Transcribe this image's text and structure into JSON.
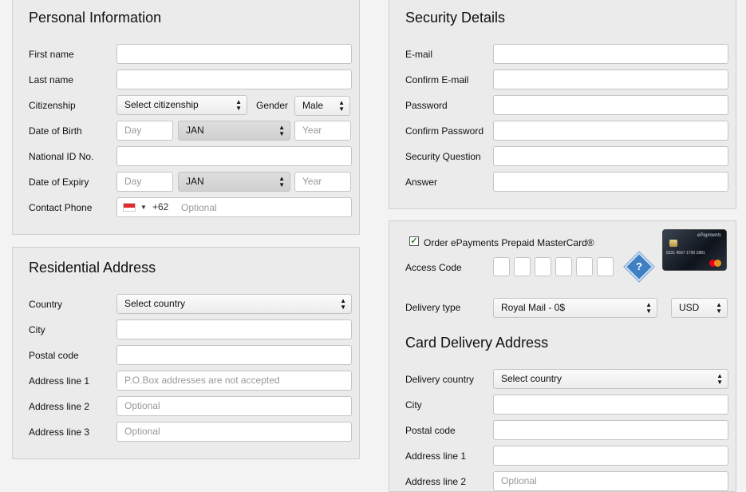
{
  "personal": {
    "title": "Personal Information",
    "first_name": "First name",
    "last_name": "Last name",
    "citizenship": "Citizenship",
    "citizenship_select": "Select citizenship",
    "gender": "Gender",
    "gender_value": "Male",
    "dob": "Date of Birth",
    "day_placeholder": "Day",
    "month_value": "JAN",
    "year_placeholder": "Year",
    "national_id": "National ID No.",
    "date_of_expiry": "Date of Expiry",
    "contact_phone": "Contact Phone",
    "phone_code": "+62",
    "phone_placeholder": "Optional"
  },
  "residential": {
    "title": "Residential Address",
    "country": "Country",
    "country_select": "Select country",
    "city": "City",
    "postal_code": "Postal code",
    "address1": "Address line 1",
    "address1_placeholder": "P.O.Box addresses are not accepted",
    "address2": "Address line 2",
    "address3": "Address line 3",
    "optional": "Optional"
  },
  "security": {
    "title": "Security Details",
    "email": "E-mail",
    "confirm_email": "Confirm E-mail",
    "password": "Password",
    "confirm_password": "Confirm Password",
    "security_question": "Security Question",
    "answer": "Answer"
  },
  "card": {
    "order_label": "Order ePayments Prepaid MasterCard®",
    "order_checked": true,
    "access_code": "Access Code",
    "delivery_type": "Delivery type",
    "delivery_value": "Royal Mail - 0$",
    "currency": "USD",
    "help_symbol": "?",
    "card_brand": "ePayments",
    "card_number": "5331 4567 1700 1881"
  },
  "delivery": {
    "title": "Card Delivery Address",
    "country": "Delivery country",
    "country_select": "Select country",
    "city": "City",
    "postal_code": "Postal code",
    "address1": "Address line 1",
    "address2": "Address line 2",
    "optional": "Optional"
  },
  "icons": {
    "select_arrows": "updown-arrow-icon",
    "flag": "indonesia-flag-icon",
    "help": "question-diamond-icon",
    "check": "checkmark-icon"
  }
}
